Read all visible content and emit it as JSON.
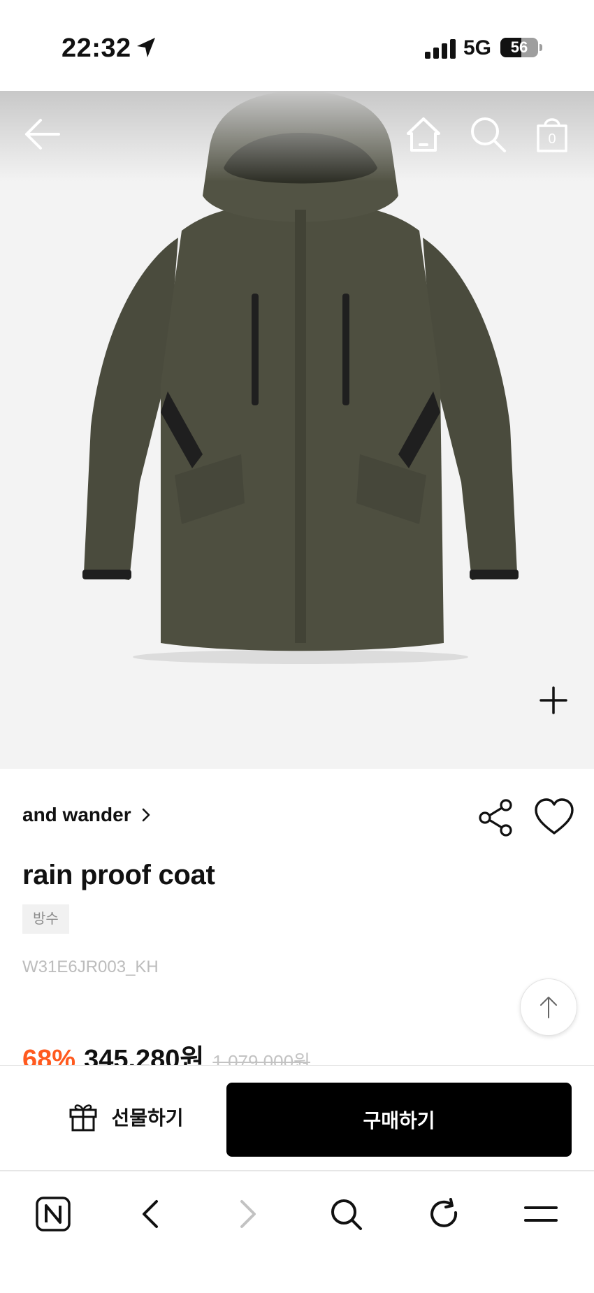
{
  "status_bar": {
    "time": "22:32",
    "network": "5G",
    "battery_level": 56,
    "battery_text": "56"
  },
  "top_nav": {
    "icons": [
      "back-arrow-icon",
      "home-icon",
      "search-icon",
      "shopping-bag-icon"
    ],
    "cart_count": "0"
  },
  "product": {
    "brand": "and wander",
    "title": "rain proof coat",
    "tag": "방수",
    "code": "W31E6JR003_KH",
    "discount": "68%",
    "price": "345,280원",
    "original_price": "1,079,000원",
    "image_colors": {
      "jacket": "#4e4f40",
      "jacket_shadow": "#3d3e31",
      "trim": "#1f1f1f"
    }
  },
  "purchase_bar": {
    "gift_label": "선물하기",
    "buy_label": "구매하기"
  },
  "browser_toolbar": {
    "icons": [
      "naver-n-icon",
      "back-icon",
      "forward-icon",
      "search-icon",
      "refresh-icon",
      "menu-icon"
    ]
  },
  "colors": {
    "discount": "#ff5a1f",
    "buy_button": "#000000",
    "hero_background": "#f3f3f3"
  }
}
